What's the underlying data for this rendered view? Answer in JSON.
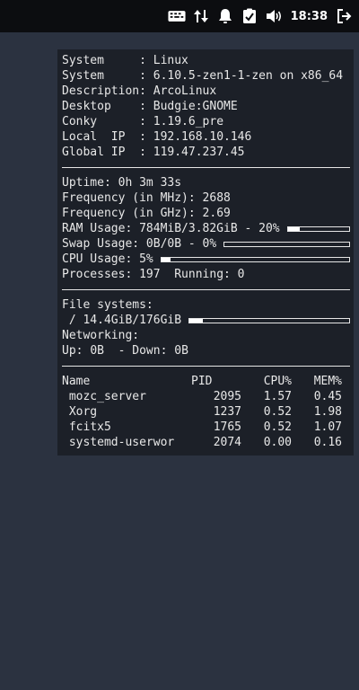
{
  "topbar": {
    "time": "18:38",
    "icons": [
      "keyboard-input-icon",
      "data-transfer-icon",
      "notification-bell-icon",
      "clipboard-check-icon",
      "volume-icon",
      "logout-icon"
    ]
  },
  "system": [
    {
      "label": "System     : ",
      "value": "Linux"
    },
    {
      "label": "System     : ",
      "value": "6.10.5-zen1-1-zen on x86_64"
    },
    {
      "label": "Description: ",
      "value": "ArcoLinux"
    },
    {
      "label": "Desktop    : ",
      "value": "Budgie:GNOME"
    },
    {
      "label": "Conky      : ",
      "value": "1.19.6_pre"
    },
    {
      "label": "Local  IP  : ",
      "value": "192.168.10.146"
    },
    {
      "label": "Global IP  : ",
      "value": "119.47.237.45"
    }
  ],
  "stats": {
    "uptime_label": "Uptime: ",
    "uptime": "0h 3m 33s",
    "freq_mhz_label": "Frequency (in MHz): ",
    "freq_mhz": "2688",
    "freq_ghz_label": "Frequency (in GHz): ",
    "freq_ghz": "2.69",
    "ram_label": "RAM Usage: ",
    "ram": "784MiB/3.82GiB - 20%",
    "ram_fraction": 0.2,
    "swap_label": "Swap Usage: ",
    "swap": "0B/0B - 0%",
    "swap_fraction": 0.0,
    "cpu_label": "CPU Usage: ",
    "cpu": "5%",
    "cpu_fraction": 0.05,
    "processes_label": "Processes: ",
    "processes": "197",
    "running_label": "  Running: ",
    "running": "0"
  },
  "filesystems": {
    "title": "File systems:",
    "root": " / 14.4GiB/176GiB",
    "root_fraction": 0.082,
    "net_title": "Networking:",
    "up_label": "Up: ",
    "up": "0B",
    "down_label": "  - Down: ",
    "down": "0B"
  },
  "processes": {
    "headers": {
      "name": "Name",
      "pid": "PID",
      "cpu": "CPU%",
      "mem": "MEM%"
    },
    "rows": [
      {
        "name": " mozc_server",
        "pid": "2095",
        "cpu": "1.57",
        "mem": "0.45"
      },
      {
        "name": " Xorg",
        "pid": "1237",
        "cpu": "0.52",
        "mem": "1.98"
      },
      {
        "name": " fcitx5",
        "pid": "1765",
        "cpu": "0.52",
        "mem": "1.07"
      },
      {
        "name": " systemd-userwor",
        "pid": "2074",
        "cpu": "0.00",
        "mem": "0.16"
      }
    ]
  }
}
